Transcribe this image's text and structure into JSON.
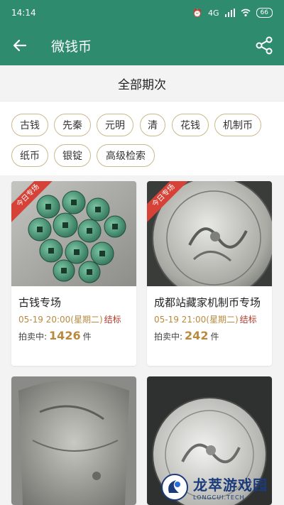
{
  "status_bar": {
    "time": "14:14",
    "network": "4G",
    "battery": "66"
  },
  "app_bar": {
    "title": "微钱币"
  },
  "section": {
    "title": "全部期次"
  },
  "filters": [
    "古钱",
    "先秦",
    "元明",
    "清",
    "花钱",
    "机制币",
    "纸币",
    "银锭",
    "高级检索"
  ],
  "auctions": [
    {
      "badge": "今日专场",
      "title": "古钱专场",
      "date": "05-19 20:00(星期二)",
      "status": "结标",
      "bid_label": "拍卖中:",
      "bid_count": "1426",
      "unit": "件"
    },
    {
      "badge": "今日专场",
      "title": "成都站藏家机制币专场",
      "date": "05-19 21:00(星期二)",
      "status": "结标",
      "bid_label": "拍卖中:",
      "bid_count": "242",
      "unit": "件"
    }
  ],
  "watermark": {
    "title": "龙萃游戏园",
    "subtitle": "LONGCUI.TECH"
  },
  "colors": {
    "primary": "#2e8b6e",
    "accent": "#b98a3e",
    "badge": "#d64237",
    "chip_border": "#c9b98c"
  }
}
